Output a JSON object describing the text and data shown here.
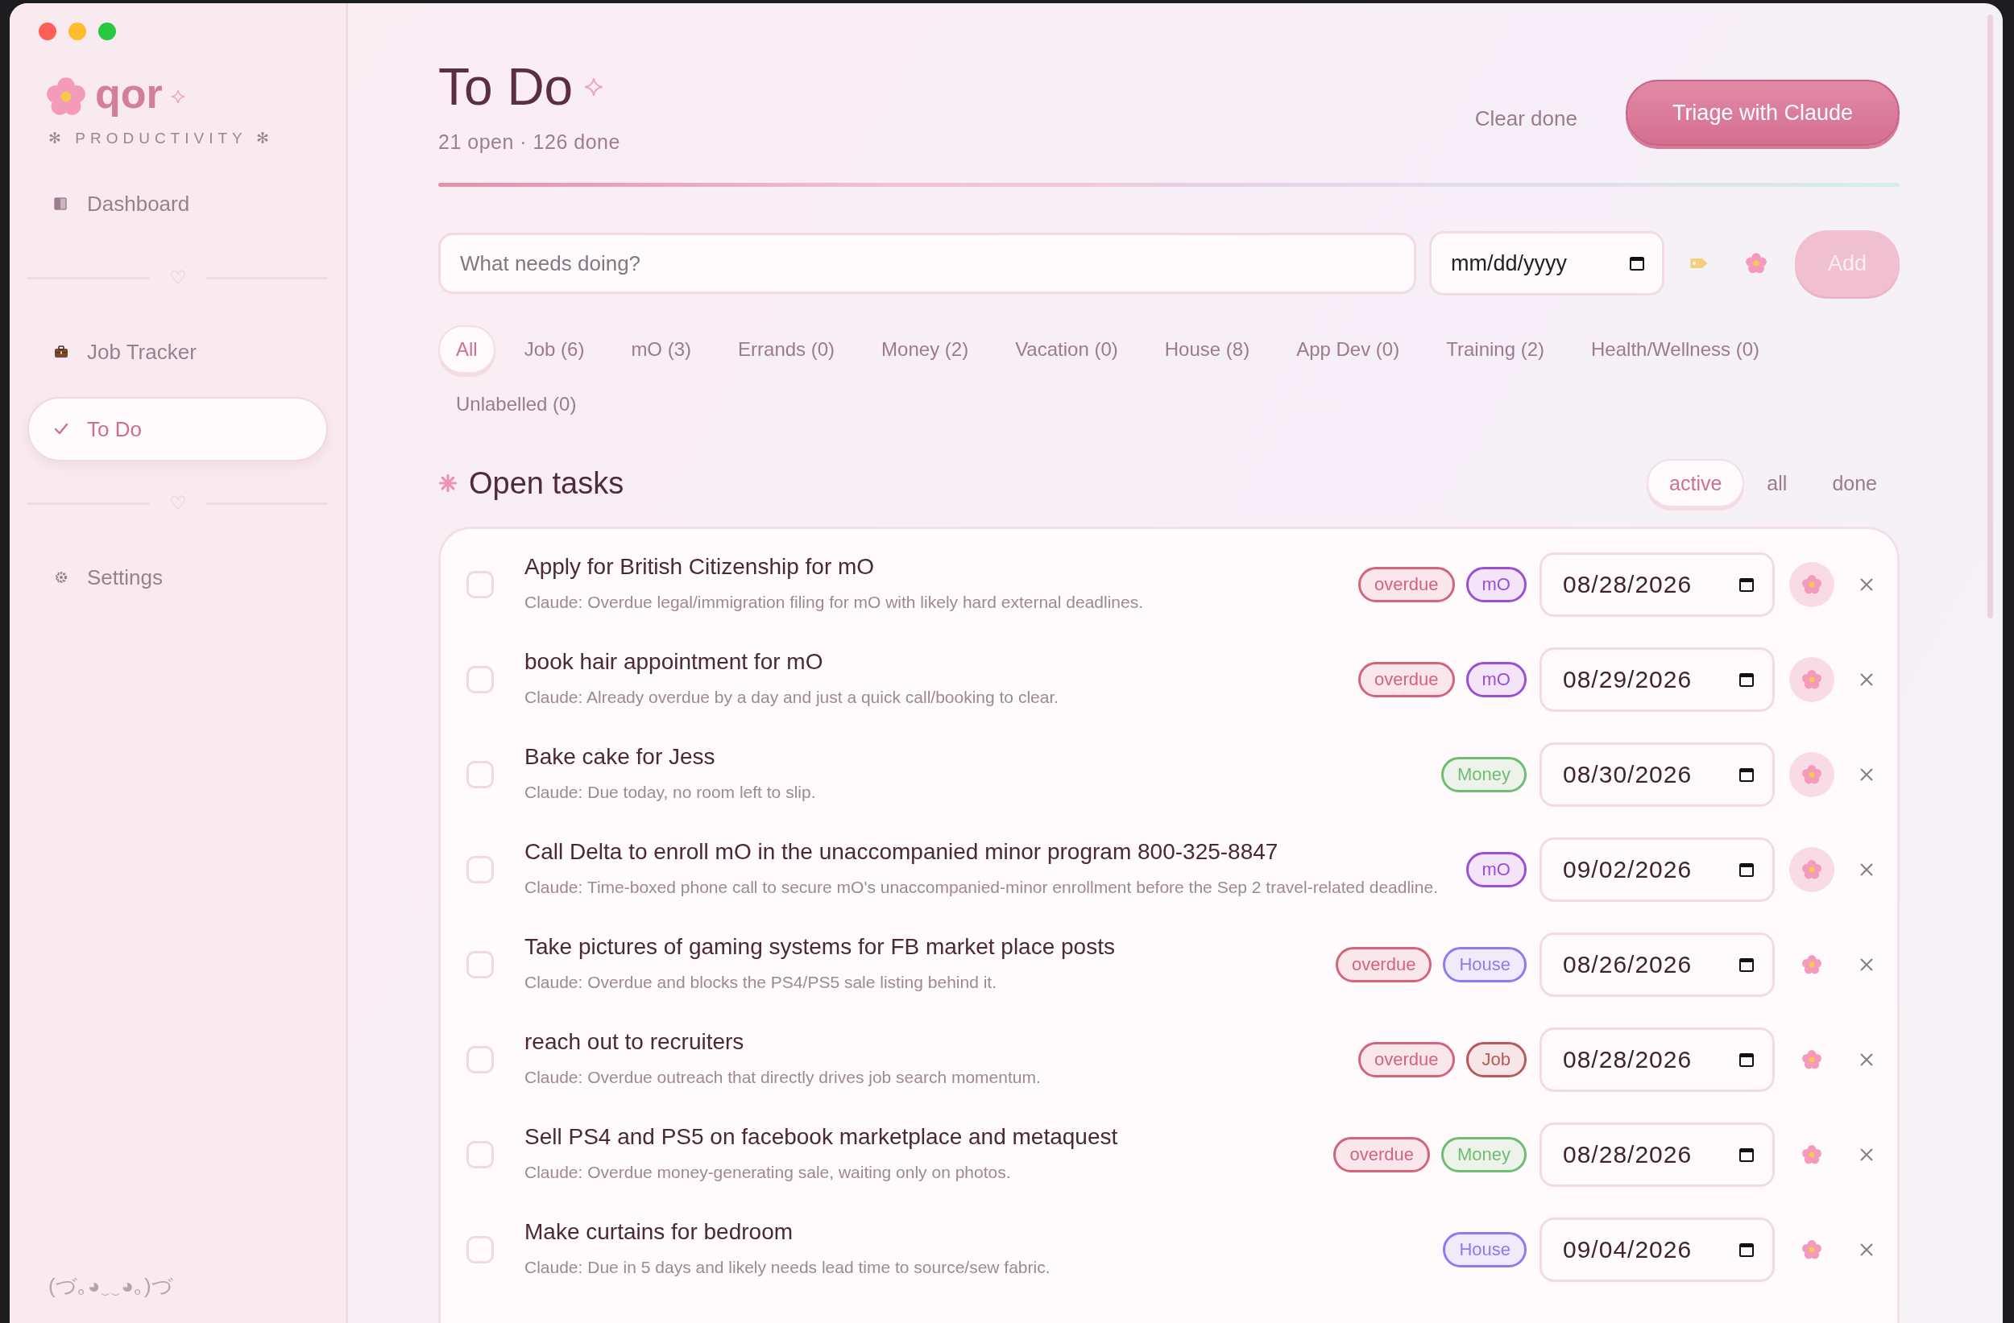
{
  "sidebar": {
    "brand": "qor",
    "tagline": "✻ PRODUCTIVITY ✻",
    "nav": [
      {
        "kind": "item",
        "label": "Dashboard",
        "selected": false
      },
      {
        "kind": "divider",
        "mark": "♡"
      },
      {
        "kind": "item",
        "label": "Job Tracker",
        "selected": false
      },
      {
        "kind": "item",
        "label": "To Do",
        "selected": true
      },
      {
        "kind": "divider",
        "mark": "♡"
      },
      {
        "kind": "item",
        "label": "Settings",
        "selected": false
      }
    ],
    "footer": "(づ｡◕‿‿◕｡)づ"
  },
  "header": {
    "title": "To Do",
    "summary": "21 open · 126 done",
    "clear": "Clear done",
    "triage": "Triage with Claude"
  },
  "composer": {
    "placeholder": "What needs doing?",
    "date_placeholder": "mm/dd/yyyy",
    "add": "Add",
    "add_disabled": true
  },
  "filters": [
    {
      "label": "All",
      "selected": true
    },
    {
      "label": "Job (6)",
      "selected": false
    },
    {
      "label": "mO (3)",
      "selected": false
    },
    {
      "label": "Errands (0)",
      "selected": false
    },
    {
      "label": "Money (2)",
      "selected": false
    },
    {
      "label": "Vacation (0)",
      "selected": false
    },
    {
      "label": "House (8)",
      "selected": false
    },
    {
      "label": "App Dev (0)",
      "selected": false
    },
    {
      "label": "Training (2)",
      "selected": false
    },
    {
      "label": "Health/Wellness (0)",
      "selected": false
    },
    {
      "label": "Unlabelled (0)",
      "selected": false
    }
  ],
  "section": {
    "title": "Open tasks",
    "views": [
      {
        "label": "active",
        "selected": true
      },
      {
        "label": "all",
        "selected": false
      },
      {
        "label": "done",
        "selected": false
      }
    ]
  },
  "tasks": [
    {
      "title": "Apply for British Citizenship for mO",
      "note": "Claude: Overdue legal/immigration filing for mO with likely hard external deadlines.",
      "checked": false,
      "tags": [
        {
          "label": "overdue",
          "color": "#d4637c"
        },
        {
          "label": "mO",
          "color": "#9a4fd4"
        }
      ],
      "due": "08/28/2026",
      "highlighted": true
    },
    {
      "title": "book hair appointment for mO",
      "note": "Claude: Already overdue by a day and just a quick call/booking to clear.",
      "checked": false,
      "tags": [
        {
          "label": "overdue",
          "color": "#d4637c"
        },
        {
          "label": "mO",
          "color": "#9a4fd4"
        }
      ],
      "due": "08/29/2026",
      "highlighted": true
    },
    {
      "title": "Bake cake for Jess",
      "note": "Claude: Due today, no room left to slip.",
      "checked": false,
      "tags": [
        {
          "label": "Money",
          "color": "#6fbd72"
        }
      ],
      "due": "08/30/2026",
      "highlighted": true
    },
    {
      "title": "Call Delta to enroll mO in the unaccompanied minor program 800-325-8847",
      "note": "Claude: Time-boxed phone call to secure mO's unaccompanied-minor enrollment before the Sep 2 travel-related deadline.",
      "checked": false,
      "tags": [
        {
          "label": "mO",
          "color": "#9a4fd4"
        }
      ],
      "due": "09/02/2026",
      "highlighted": true
    },
    {
      "title": "Take pictures of gaming systems for FB market place posts",
      "note": "Claude: Overdue and blocks the PS4/PS5 sale listing behind it.",
      "checked": false,
      "tags": [
        {
          "label": "overdue",
          "color": "#d4637c"
        },
        {
          "label": "House",
          "color": "#8a7cf2"
        }
      ],
      "due": "08/26/2026",
      "highlighted": false
    },
    {
      "title": "reach out to recruiters",
      "note": "Claude: Overdue outreach that directly drives job search momentum.",
      "checked": false,
      "tags": [
        {
          "label": "overdue",
          "color": "#d4637c"
        },
        {
          "label": "Job",
          "color": "#b95a5a"
        }
      ],
      "due": "08/28/2026",
      "highlighted": false
    },
    {
      "title": "Sell PS4 and PS5 on facebook marketplace and metaquest",
      "note": "Claude: Overdue money-generating sale, waiting only on photos.",
      "checked": false,
      "tags": [
        {
          "label": "overdue",
          "color": "#d4637c"
        },
        {
          "label": "Money",
          "color": "#6fbd72"
        }
      ],
      "due": "08/28/2026",
      "highlighted": false
    },
    {
      "title": "Make curtains for bedroom",
      "note": "Claude: Due in 5 days and likely needs lead time to source/sew fabric.",
      "checked": false,
      "tags": [
        {
          "label": "House",
          "color": "#8a7cf2"
        }
      ],
      "due": "09/04/2026",
      "highlighted": false
    }
  ]
}
